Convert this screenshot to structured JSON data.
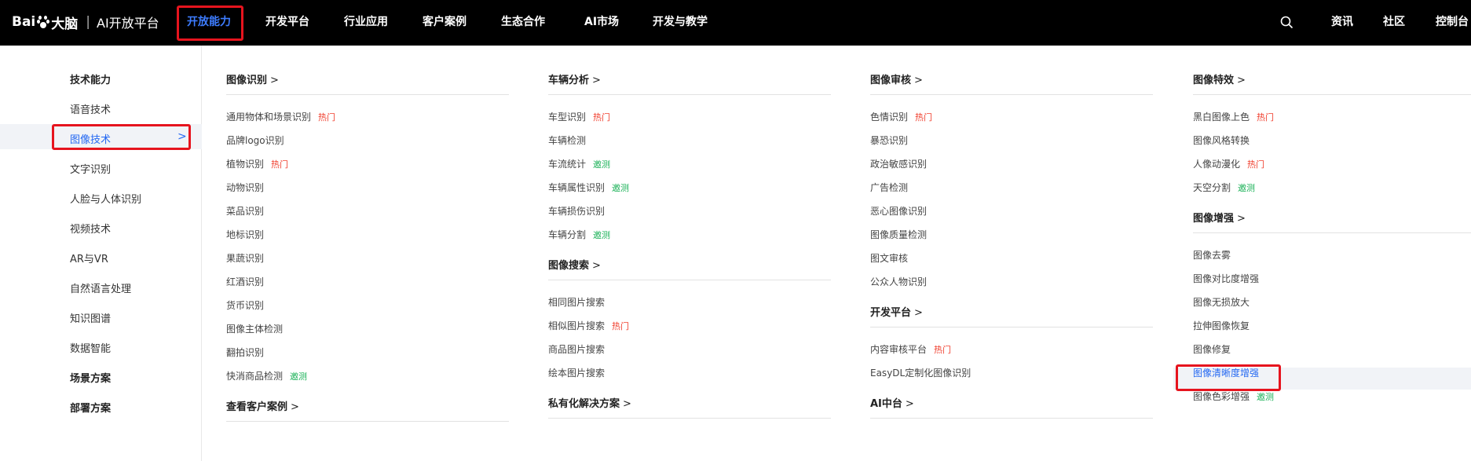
{
  "topbar": {
    "logo_text_left": "Bai",
    "logo_text_right": "大脑",
    "logo_sub": "AI开放平台",
    "nav": [
      "开放能力",
      "开发平台",
      "行业应用",
      "客户案例",
      "生态合作",
      "AI市场",
      "开发与教学"
    ],
    "right_links": [
      "资讯",
      "社区",
      "控制台"
    ]
  },
  "sidebar": {
    "items": [
      {
        "label": "技术能力",
        "style": "bold"
      },
      {
        "label": "语音技术",
        "style": "normal"
      },
      {
        "label": "图像技术",
        "style": "active"
      },
      {
        "label": "文字识别",
        "style": "normal"
      },
      {
        "label": "人脸与人体识别",
        "style": "normal"
      },
      {
        "label": "视频技术",
        "style": "normal"
      },
      {
        "label": "AR与VR",
        "style": "normal"
      },
      {
        "label": "自然语言处理",
        "style": "normal"
      },
      {
        "label": "知识图谱",
        "style": "normal"
      },
      {
        "label": "数据智能",
        "style": "normal"
      },
      {
        "label": "场景方案",
        "style": "bold"
      },
      {
        "label": "部署方案",
        "style": "bold"
      }
    ],
    "chevron": ">"
  },
  "columns": [
    {
      "sections": [
        {
          "title": "图像识别",
          "links": [
            {
              "label": "通用物体和场景识别",
              "tag": "热门"
            },
            {
              "label": "品牌logo识别"
            },
            {
              "label": "植物识别",
              "tag": "热门"
            },
            {
              "label": "动物识别"
            },
            {
              "label": "菜品识别"
            },
            {
              "label": "地标识别"
            },
            {
              "label": "果蔬识别"
            },
            {
              "label": "红酒识别"
            },
            {
              "label": "货币识别"
            },
            {
              "label": "图像主体检测"
            },
            {
              "label": "翻拍识别"
            },
            {
              "label": "快消商品检测",
              "tag": "邀测"
            }
          ]
        },
        {
          "title": "查看客户案例",
          "links": []
        }
      ]
    },
    {
      "sections": [
        {
          "title": "车辆分析",
          "links": [
            {
              "label": "车型识别",
              "tag": "热门"
            },
            {
              "label": "车辆检测"
            },
            {
              "label": "车流统计",
              "tag": "邀测"
            },
            {
              "label": "车辆属性识别",
              "tag": "邀测"
            },
            {
              "label": "车辆损伤识别"
            },
            {
              "label": "车辆分割",
              "tag": "邀测"
            }
          ]
        },
        {
          "title": "图像搜索",
          "links": [
            {
              "label": "相同图片搜索"
            },
            {
              "label": "相似图片搜索",
              "tag": "热门"
            },
            {
              "label": "商品图片搜索"
            },
            {
              "label": "绘本图片搜索"
            }
          ]
        },
        {
          "title": "私有化解决方案",
          "links": []
        }
      ]
    },
    {
      "sections": [
        {
          "title": "图像审核",
          "links": [
            {
              "label": "色情识别",
              "tag": "热门"
            },
            {
              "label": "暴恐识别"
            },
            {
              "label": "政治敏感识别"
            },
            {
              "label": "广告检测"
            },
            {
              "label": "恶心图像识别"
            },
            {
              "label": "图像质量检测"
            },
            {
              "label": "图文审核"
            },
            {
              "label": "公众人物识别"
            }
          ]
        },
        {
          "title": "开发平台",
          "links": [
            {
              "label": "内容审核平台",
              "tag": "热门"
            },
            {
              "label": "EasyDL定制化图像识别"
            }
          ]
        },
        {
          "title": "AI中台",
          "links": []
        }
      ]
    },
    {
      "sections": [
        {
          "title": "图像特效",
          "links": [
            {
              "label": "黑白图像上色",
              "tag": "热门"
            },
            {
              "label": "图像风格转换"
            },
            {
              "label": "人像动漫化",
              "tag": "热门"
            },
            {
              "label": "天空分割",
              "tag": "邀测"
            }
          ]
        },
        {
          "title": "图像增强",
          "links": [
            {
              "label": "图像去雾"
            },
            {
              "label": "图像对比度增强"
            },
            {
              "label": "图像无损放大"
            },
            {
              "label": "拉伸图像恢复"
            },
            {
              "label": "图像修复"
            },
            {
              "label": "图像清晰度增强",
              "active": true
            },
            {
              "label": "图像色彩增强",
              "tag": "邀测"
            }
          ]
        }
      ]
    }
  ],
  "arrow_glyph": ">",
  "colors": {
    "hot": "#f03f2e",
    "beta": "#1ab157",
    "active": "#2468f2",
    "highlight_box": "#e6141e"
  }
}
